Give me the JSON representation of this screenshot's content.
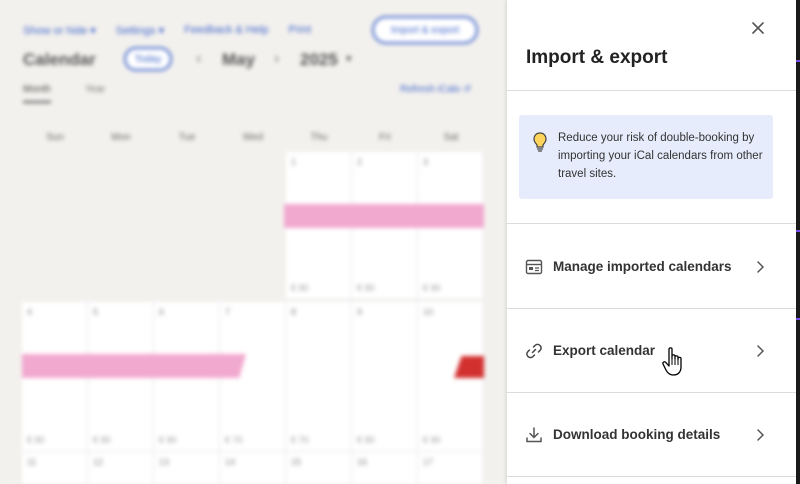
{
  "calendar": {
    "nav": [
      "Show or hide ▾",
      "Settings ▾",
      "Feedback & Help",
      "Print"
    ],
    "import_export_button": "Import & export",
    "title": "Calendar",
    "today_button": "Today",
    "month": "May",
    "year": "2025",
    "view_tabs": [
      "Month",
      "Year"
    ],
    "refresh": "Refresh iCals ↺",
    "weekdays": [
      "Sun",
      "Mon",
      "Tue",
      "Wed",
      "Thu",
      "Fri",
      "Sat"
    ],
    "week1": {
      "days": [
        "1",
        "2",
        "3"
      ],
      "prices": [
        "€ 90",
        "€ 90",
        "€ 90"
      ]
    },
    "week2": {
      "days": [
        "4",
        "5",
        "6",
        "7",
        "8",
        "9",
        "10"
      ],
      "prices": [
        "€ 90",
        "€ 90",
        "€ 90",
        "€ 70",
        "€ 70",
        "€ 90",
        "€ 90"
      ]
    },
    "week3": {
      "days": [
        "11",
        "12",
        "13",
        "14",
        "15",
        "16",
        "17"
      ]
    }
  },
  "panel": {
    "title": "Import & export",
    "info_text": "Reduce your risk of double-booking by importing your iCal calendars from other travel sites.",
    "items": [
      {
        "label": "Manage imported calendars",
        "icon": "calendar-list-icon"
      },
      {
        "label": "Export calendar",
        "icon": "link-icon"
      },
      {
        "label": "Download booking details",
        "icon": "download-icon"
      }
    ]
  }
}
